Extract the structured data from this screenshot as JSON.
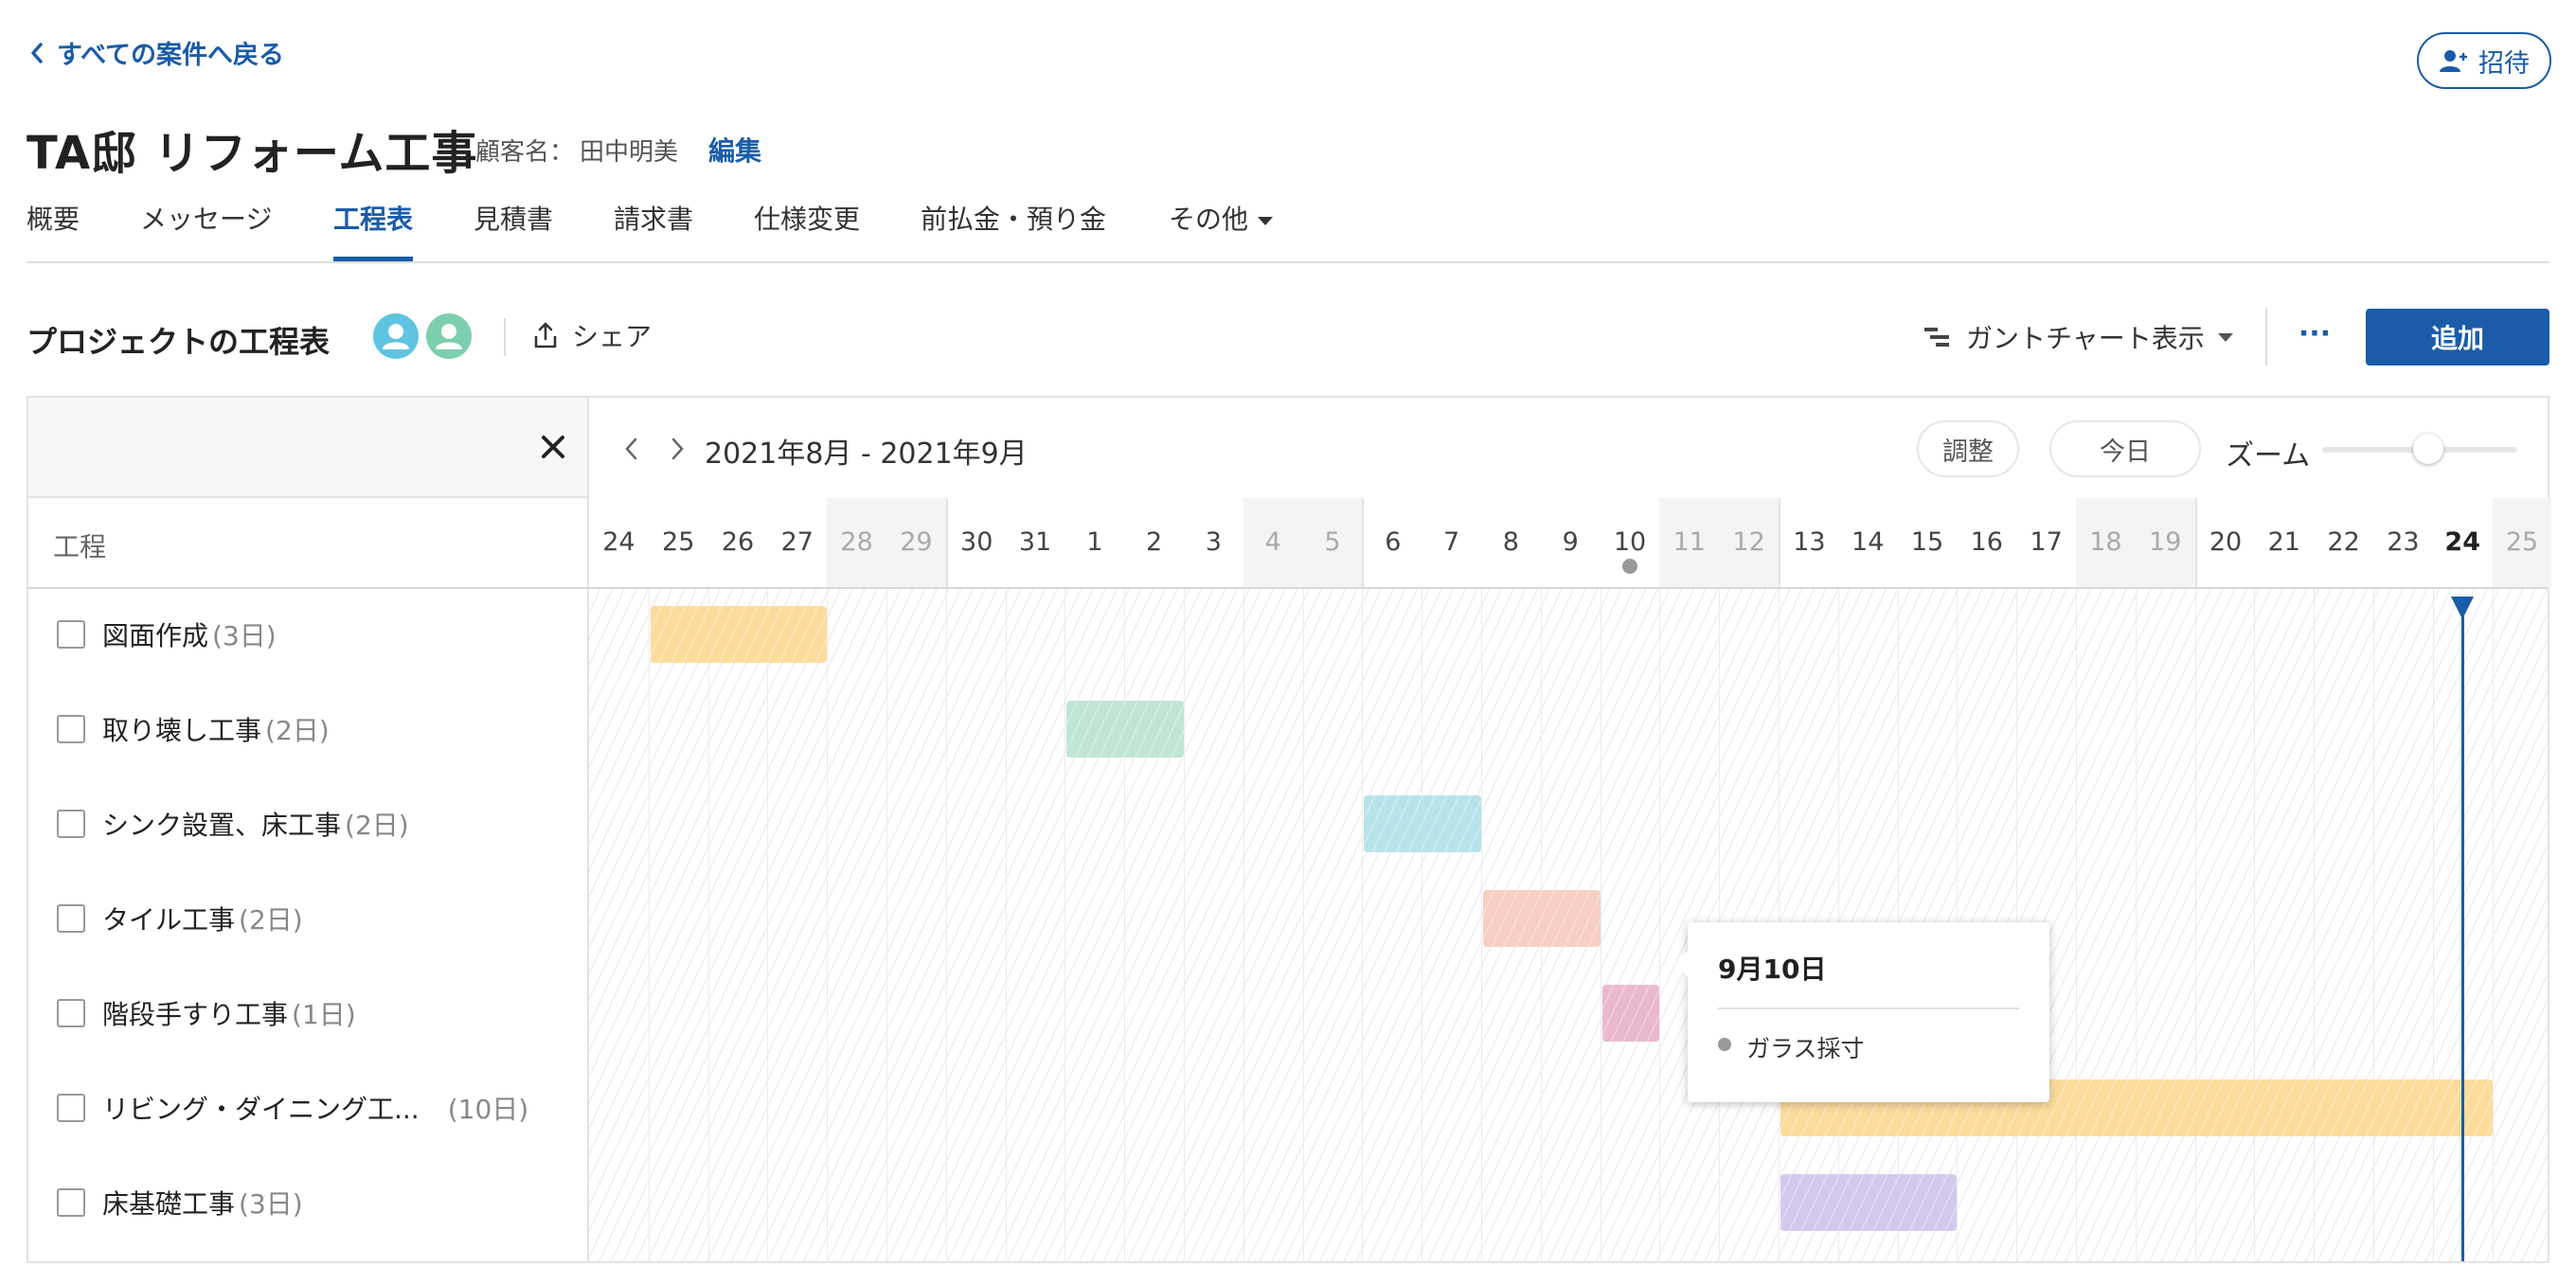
{
  "header": {
    "back_label": "すべての案件へ戻る",
    "invite_label": "招待"
  },
  "project": {
    "title": "TA邸 リフォーム工事",
    "client_label": "顧客名：",
    "client_name": "田中明美",
    "edit_label": "編集"
  },
  "tabs": [
    {
      "label": "概要"
    },
    {
      "label": "メッセージ"
    },
    {
      "label": "工程表",
      "active": true
    },
    {
      "label": "見積書"
    },
    {
      "label": "請求書"
    },
    {
      "label": "仕様変更"
    },
    {
      "label": "前払金・預り金"
    },
    {
      "label": "その他"
    }
  ],
  "schedule": {
    "section_title": "プロジェクトの工程表",
    "share_label": "シェア",
    "view_label": "ガントチャート表示",
    "more_label": "···",
    "add_label": "追加"
  },
  "gantt": {
    "date_range": "2021年8月 - 2021年9月",
    "adjust_label": "調整",
    "today_label": "今日",
    "zoom_label": "ズーム",
    "zoom_level": 0.72,
    "column_label": "工程",
    "days": [
      "24",
      "25",
      "26",
      "27",
      "28",
      "29",
      "30",
      "31",
      "1",
      "2",
      "3",
      "4",
      "5",
      "6",
      "7",
      "8",
      "9",
      "10",
      "11",
      "12",
      "13",
      "14",
      "15",
      "16",
      "17",
      "18",
      "19",
      "20",
      "21",
      "22",
      "23",
      "24",
      "25"
    ],
    "weekend_indices": [
      4,
      5,
      11,
      12,
      18,
      19,
      25,
      26,
      32
    ],
    "today_index": 31,
    "tasks": [
      {
        "name": "図面作成",
        "duration": "(3日)",
        "start_index": 1,
        "span": 3,
        "color": "#fbdc9b"
      },
      {
        "name": "取り壊し工事",
        "duration": "(2日)",
        "start_index": 8,
        "span": 2,
        "color": "#bfe6d4"
      },
      {
        "name": "シンク設置、床工事",
        "duration": "(2日)",
        "start_index": 13,
        "span": 2,
        "color": "#b7e2ea"
      },
      {
        "name": "タイル工事",
        "duration": "(2日)",
        "start_index": 15,
        "span": 2,
        "color": "#f7cfc4"
      },
      {
        "name": "階段手すり工事",
        "duration": "(1日)",
        "start_index": 17,
        "span": 1,
        "color": "#eab8cf"
      },
      {
        "name": "リビング・ダイニング工...",
        "duration": "(10日)",
        "start_index": 20,
        "span": 12,
        "color": "#fbdc9b"
      },
      {
        "name": "床基礎工事",
        "duration": "(3日)",
        "start_index": 20,
        "span": 3,
        "color": "#d5c8ee"
      }
    ],
    "milestone": {
      "day_index": 17,
      "color": "#999999"
    },
    "tooltip": {
      "date": "9月10日",
      "item": "ガラス採寸"
    }
  },
  "colors": {
    "accent": "#1a5ca8"
  }
}
